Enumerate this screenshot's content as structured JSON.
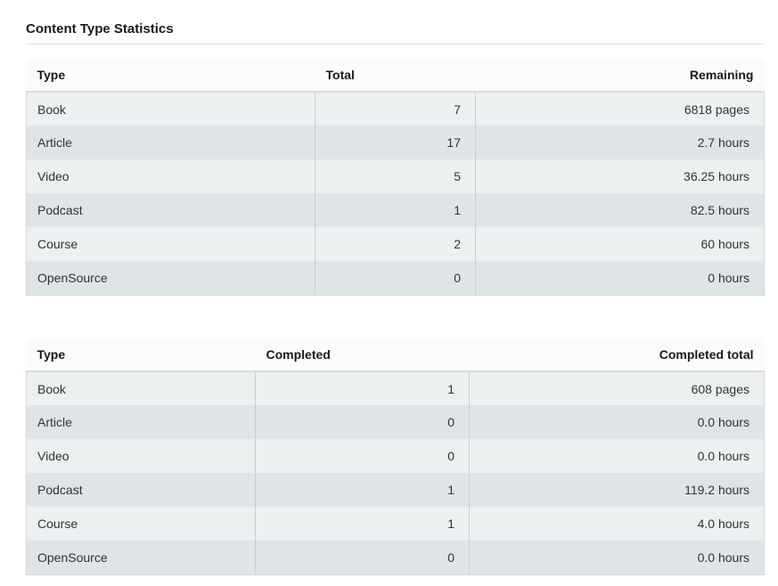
{
  "section": {
    "title": "Content Type Statistics"
  },
  "totals_table": {
    "headers": [
      "Type",
      "Total",
      "Remaining"
    ],
    "rows": [
      [
        "Book",
        "7",
        "6818 pages"
      ],
      [
        "Article",
        "17",
        "2.7 hours"
      ],
      [
        "Video",
        "5",
        "36.25 hours"
      ],
      [
        "Podcast",
        "1",
        "82.5 hours"
      ],
      [
        "Course",
        "2",
        "60 hours"
      ],
      [
        "OpenSource",
        "0",
        "0 hours"
      ]
    ]
  },
  "completed_table": {
    "headers": [
      "Type",
      "Completed",
      "Completed total"
    ],
    "rows": [
      [
        "Book",
        "1",
        "608 pages"
      ],
      [
        "Article",
        "0",
        "0.0 hours"
      ],
      [
        "Video",
        "0",
        "0.0 hours"
      ],
      [
        "Podcast",
        "1",
        "119.2 hours"
      ],
      [
        "Course",
        "1",
        "4.0 hours"
      ],
      [
        "OpenSource",
        "0",
        "0.0 hours"
      ]
    ]
  }
}
